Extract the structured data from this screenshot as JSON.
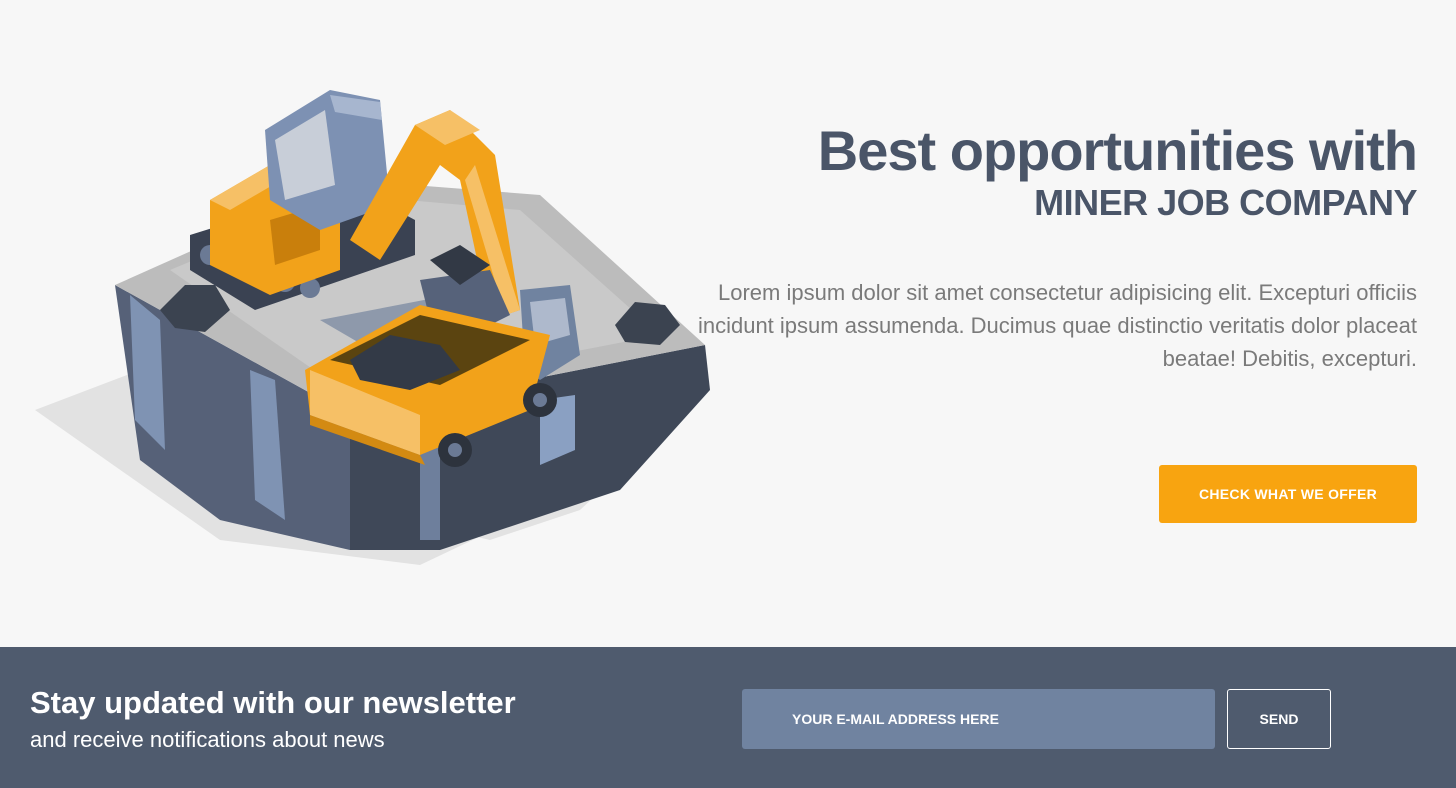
{
  "hero": {
    "headline": "Best opportunities with",
    "subheadline": "MINER JOB COMPANY",
    "lead": "Lorem ipsum dolor sit amet consectetur adipisicing elit. Excepturi officiis incidunt ipsum assumenda. Ducimus quae distinctio veritatis dolor placeat beatae! Debitis, excepturi.",
    "cta_label": "CHECK WHAT WE OFFER",
    "illustration_icon": "mining-excavator-truck-illustration"
  },
  "newsletter": {
    "title": "Stay updated with our newsletter",
    "subtitle": "and receive notifications about news",
    "email_placeholder": "YOUR E-MAIL ADDRESS HERE",
    "send_label": "SEND"
  },
  "colors": {
    "accent": "#f8a410",
    "text_dark": "#4a5568",
    "footer_bg": "#4f5b6e",
    "input_bg": "#7083a0"
  }
}
